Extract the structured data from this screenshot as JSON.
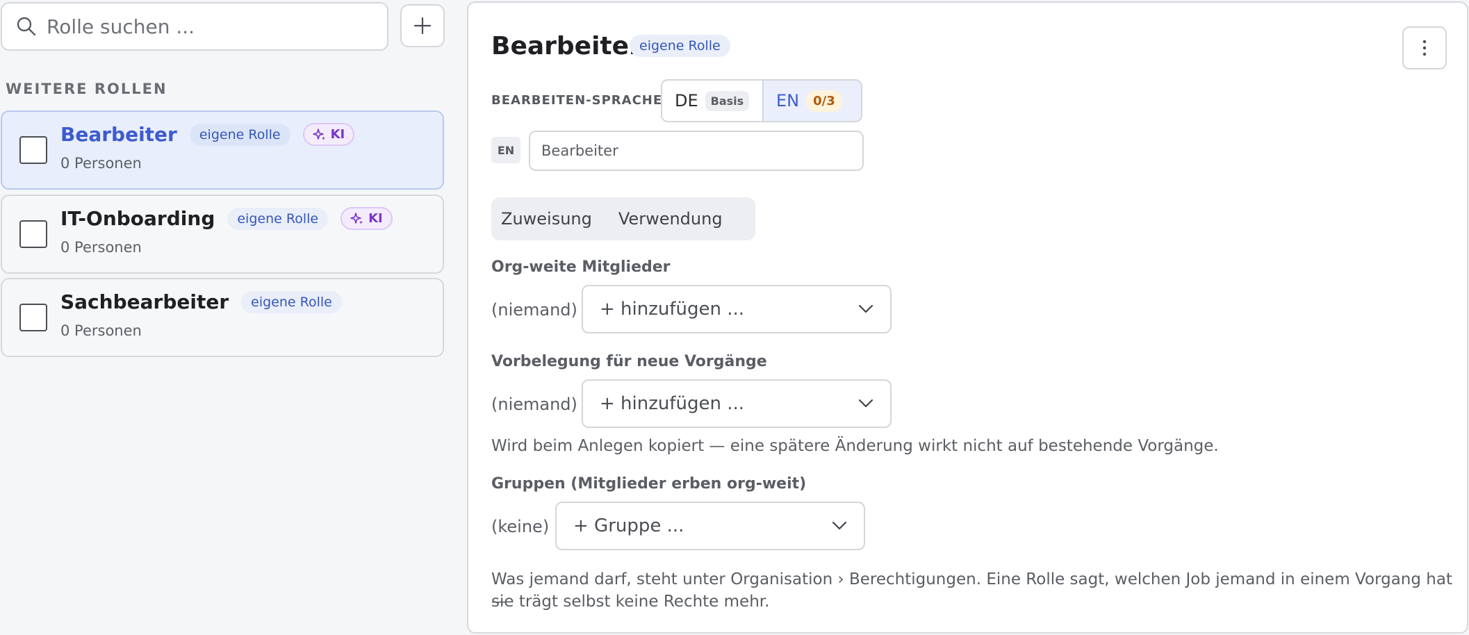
{
  "search": {
    "placeholder": "Rolle suchen ..."
  },
  "sidebar": {
    "section_label": "WEITERE ROLLEN",
    "roles": [
      {
        "name": "Bearbeiter",
        "tag": "eigene Rolle",
        "ki": "KI",
        "count": "0 Personen"
      },
      {
        "name": "IT-Onboarding",
        "tag": "eigene Rolle",
        "ki": "KI",
        "count": "0 Personen"
      },
      {
        "name": "Sachbearbeiter",
        "tag": "eigene Rolle",
        "count": "0 Personen"
      }
    ]
  },
  "detail": {
    "title": "Bearbeiter",
    "title_badge": "eigene Rolle",
    "lang_label": "BEARBEITEN-SPRACHE",
    "lang_de": "DE",
    "lang_de_badge": "Basis",
    "lang_en": "EN",
    "lang_en_progress": "0/3",
    "field_lang": "EN",
    "name_value": "Bearbeiter",
    "tabs": [
      "Zuweisung",
      "Verwendung"
    ],
    "org_members": {
      "heading": "Org-weite Mitglieder",
      "empty": "(niemand)",
      "dropdown": "+ hinzufügen ..."
    },
    "defaults": {
      "heading": "Vorbelegung für neue Vorgänge",
      "empty": "(niemand)",
      "dropdown": "+ hinzufügen ...",
      "hint": "Wird beim Anlegen kopiert — eine spätere Änderung wirkt nicht auf bestehende Vorgänge."
    },
    "groups": {
      "heading": "Gruppen (Mitglieder erben org-weit)",
      "empty": "(keine)",
      "dropdown": "+ Gruppe ..."
    },
    "footer_line1": "Was jemand darf, steht unter Organisation › Berechtigungen. Eine Rolle sagt, welchen Job jemand in einem Vorgang hat —",
    "footer_line2": "sie trägt selbst keine Rechte mehr."
  }
}
